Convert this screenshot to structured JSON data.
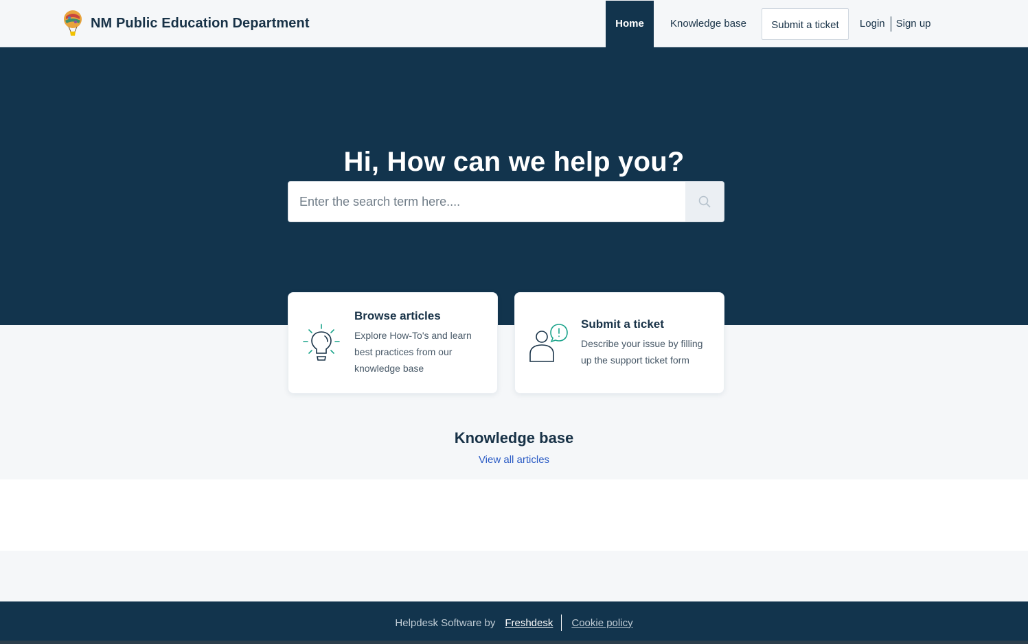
{
  "header": {
    "brand_name": "NM Public Education Department",
    "nav": {
      "home": "Home",
      "knowledge_base": "Knowledge base",
      "submit_ticket": "Submit a ticket",
      "login": "Login",
      "signup": "Sign up"
    }
  },
  "hero": {
    "title": "Hi, How can we help you?",
    "search_placeholder": "Enter the search term here....",
    "search_icon": "search-icon"
  },
  "cards": [
    {
      "title": "Browse articles",
      "description": "Explore How-To's and learn best practices from our knowledge base",
      "icon": "lightbulb-icon"
    },
    {
      "title": "Submit a ticket",
      "description": "Describe your issue by filling up the support ticket form",
      "icon": "person-alert-icon"
    }
  ],
  "knowledge_base": {
    "title": "Knowledge base",
    "view_all": "View all articles"
  },
  "footer": {
    "by_text": "Helpdesk Software by",
    "freshdesk": "Freshdesk",
    "cookie_policy": "Cookie policy"
  },
  "colors": {
    "navy": "#12344d",
    "accent_green": "#1aa38a",
    "link_blue": "#2c5cc5"
  }
}
